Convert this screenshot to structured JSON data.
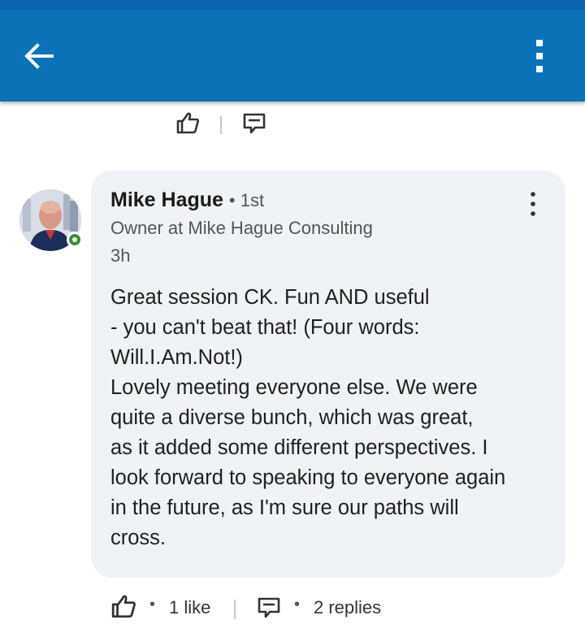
{
  "colors": {
    "appbar": "#0a73b7",
    "bubble": "#f1f2f6",
    "presence": "#378e35",
    "icon": "#333333"
  },
  "header": {
    "back_icon": "arrow-left-icon",
    "menu_icon": "more-vertical-icon"
  },
  "comment": {
    "author": "Mike Hague",
    "degree": "• 1st",
    "headline": "Owner at Mike Hague Consulting",
    "time": "3h",
    "text": "Great session CK. Fun AND useful\n- you can't beat that! (Four words:\nWill.I.Am.Not!)\nLovely meeting everyone else. We were\nquite a diverse bunch, which was great,\nas it added some different perspectives. I\nlook forward to speaking to everyone again\nin the future, as I'm sure our paths will\ncross.",
    "likes_label": "1 like",
    "replies_label": "2 replies",
    "separator": "•"
  }
}
